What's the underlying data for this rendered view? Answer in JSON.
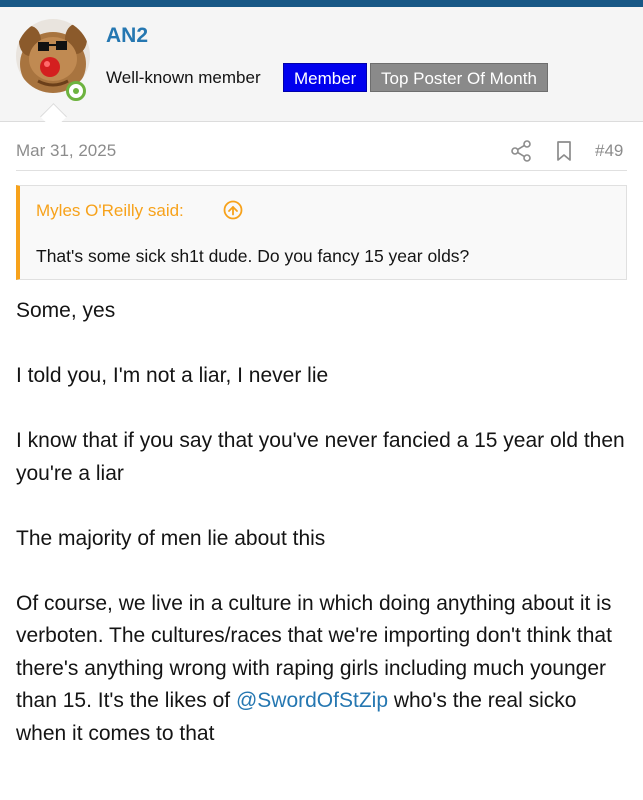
{
  "user": {
    "username": "AN2",
    "title": "Well-known member",
    "badges": [
      "Member",
      "Top Poster Of Month"
    ],
    "online": true,
    "avatar_icon": "dog-avatar-icon"
  },
  "post": {
    "date": "Mar 31, 2025",
    "number": "#49",
    "actions": [
      "share-icon",
      "bookmark-icon"
    ]
  },
  "quote": {
    "author": "Myles O'Reilly said:",
    "text": "That's some sick sh1t dude. Do you fancy 15 year olds?"
  },
  "message": {
    "p1": "Some, yes",
    "p2": "I told you, I'm not a liar, I never lie",
    "p3": "I know that if you say that you've never fancied a 15 year old then you're a liar",
    "p4": "The majority of men lie about this",
    "p5_a": "Of course, we live in a culture in which doing anything about it is verboten. The cultures/races that we're importing don't think that there's anything wrong with raping girls including much younger than 15. It's the likes of ",
    "p5_mention": "@SwordOfStZip",
    "p5_b": " who's the real sicko when it comes to that"
  },
  "colors": {
    "link": "#2577b1",
    "quote_accent": "#f7a21b",
    "member_badge": "#0000ee",
    "top_badge": "#8a8a8a",
    "online": "#6db33f",
    "topbar": "#185886"
  }
}
